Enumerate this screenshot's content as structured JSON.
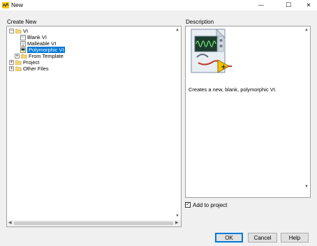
{
  "window": {
    "title": "New"
  },
  "titlebar_buttons": {
    "minimize": "—",
    "maximize": "☐",
    "close": "✕"
  },
  "create_new": {
    "label": "Create New",
    "tree": [
      {
        "label": "VI",
        "expander": "−",
        "icon": "folder-open-icon"
      },
      {
        "label": "Blank VI",
        "icon": "blank-vi-icon"
      },
      {
        "label": "Malleable VI",
        "icon": "malleable-vi-icon"
      },
      {
        "label": "Polymorphic VI",
        "icon": "polymorphic-vi-icon",
        "selected": true
      },
      {
        "label": "From Template",
        "expander": "+",
        "icon": "folder-icon"
      },
      {
        "label": "Project",
        "expander": "+",
        "icon": "folder-icon"
      },
      {
        "label": "Other Files",
        "expander": "+",
        "icon": "folder-icon"
      }
    ]
  },
  "description": {
    "label": "Description",
    "text": "Creates a new, blank, polymorphic VI."
  },
  "add_to_project": {
    "label": "Add to project",
    "checked": true,
    "check": "✓"
  },
  "buttons": {
    "ok": "OK",
    "cancel": "Cancel",
    "help": "Help"
  },
  "scroll_arrows": {
    "up": "▲",
    "down": "▼",
    "left": "◀",
    "right": "▶"
  },
  "colors": {
    "selection": "#0078d7",
    "folder": "#e8c15a",
    "preview_bg": "#d8e3ee"
  }
}
